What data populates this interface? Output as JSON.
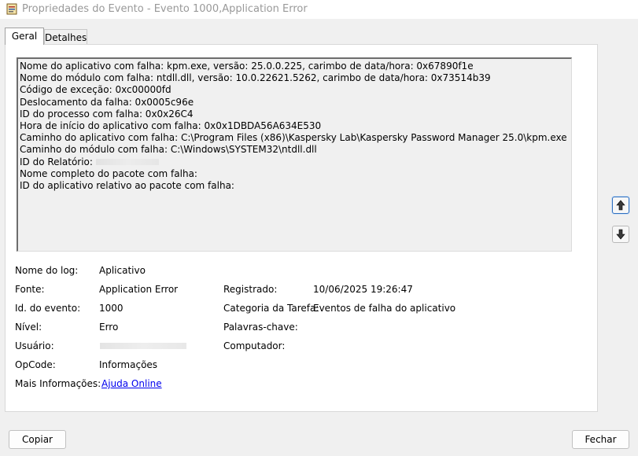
{
  "window": {
    "title": "Propriedades do Evento - Evento 1000,Application Error"
  },
  "tabs": [
    {
      "label": "Geral",
      "selected": true
    },
    {
      "label": "Detalhes",
      "selected": false
    }
  ],
  "description": {
    "lines": [
      "Nome do aplicativo com falha: kpm.exe, versão: 25.0.0.225, carimbo de data/hora: 0x67890f1e",
      "Nome do módulo com falha: ntdll.dll, versão: 10.0.22621.5262, carimbo de data/hora: 0x73514b39",
      "Código de exceção: 0xc00000fd",
      "Deslocamento da falha: 0x0005c96e",
      "ID do processo com falha: 0x0x26C4",
      "Hora de início do aplicativo com falha: 0x0x1DBDA56A634E530",
      "Caminho do aplicativo com falha: C:\\Program Files (x86)\\Kaspersky Lab\\Kaspersky Password Manager 25.0\\kpm.exe",
      "Caminho do módulo com falha: C:\\Windows\\SYSTEM32\\ntdll.dll",
      "ID do Relatório:",
      "Nome completo do pacote com falha:",
      "ID do aplicativo relativo ao pacote com falha:"
    ]
  },
  "fields": {
    "log_name": {
      "label": "Nome do log:",
      "value": "Aplicativo"
    },
    "source": {
      "label": "Fonte:",
      "value": "Application Error"
    },
    "logged": {
      "label": "Registrado:",
      "value": "10/06/2025 19:26:47"
    },
    "event_id": {
      "label": "Id. do evento:",
      "value": "1000"
    },
    "task_category": {
      "label": "Categoria da Tarefa:",
      "value": "Eventos de falha do aplicativo"
    },
    "level": {
      "label": "Nível:",
      "value": "Erro"
    },
    "keywords": {
      "label": "Palavras-chave:",
      "value": ""
    },
    "user": {
      "label": "Usuário:",
      "value": ""
    },
    "computer": {
      "label": "Computador:",
      "value": ""
    },
    "opcode": {
      "label": "OpCode:",
      "value": "Informações"
    },
    "more_info": {
      "label": "Mais Informações:",
      "value": "Ajuda Online"
    }
  },
  "buttons": {
    "copy": "Copiar",
    "close": "Fechar"
  },
  "icons": {
    "app": "event-viewer-icon",
    "up": "arrow-up-icon",
    "down": "arrow-down-icon"
  },
  "colors": {
    "link": "#0000ee",
    "focus": "#2f6fbf"
  }
}
